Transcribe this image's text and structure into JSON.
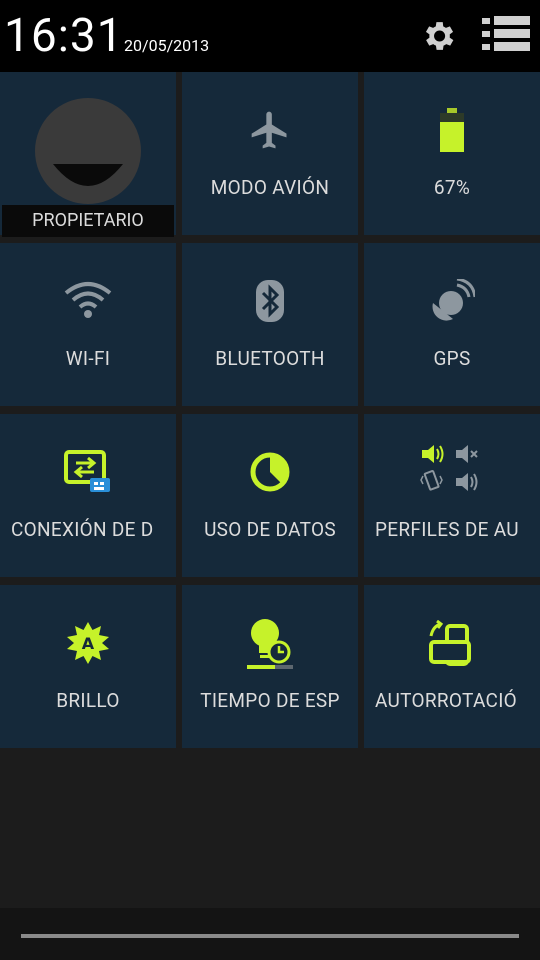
{
  "status": {
    "time": "16:31",
    "date": "20/05/2013"
  },
  "header": {
    "settings_icon": "gear-icon",
    "list_icon": "list-icon"
  },
  "tiles": [
    {
      "label": "PROPIETARIO",
      "icon": "avatar-icon"
    },
    {
      "label": "MODO AVIÓN",
      "icon": "airplane-icon"
    },
    {
      "label": "67%",
      "icon": "battery-icon",
      "level": 67
    },
    {
      "label": "WI-FI",
      "icon": "wifi-icon"
    },
    {
      "label": "BLUETOOTH",
      "icon": "bluetooth-icon"
    },
    {
      "label": "GPS",
      "icon": "gps-icon"
    },
    {
      "label": "CONEXIÓN DE D",
      "icon": "tethering-icon"
    },
    {
      "label": "USO DE DATOS",
      "icon": "data-usage-icon"
    },
    {
      "label": "PERFILES DE AU",
      "icon": "audio-profiles-icon"
    },
    {
      "label": "BRILLO",
      "icon": "brightness-icon"
    },
    {
      "label": "TIEMPO DE ESP",
      "icon": "screen-timeout-icon"
    },
    {
      "label": "AUTORROTACIÓ",
      "icon": "auto-rotate-icon"
    }
  ],
  "colors": {
    "accent": "#c6f22a",
    "inactive": "#9aa3ab",
    "tile_bg": "#15293a"
  }
}
